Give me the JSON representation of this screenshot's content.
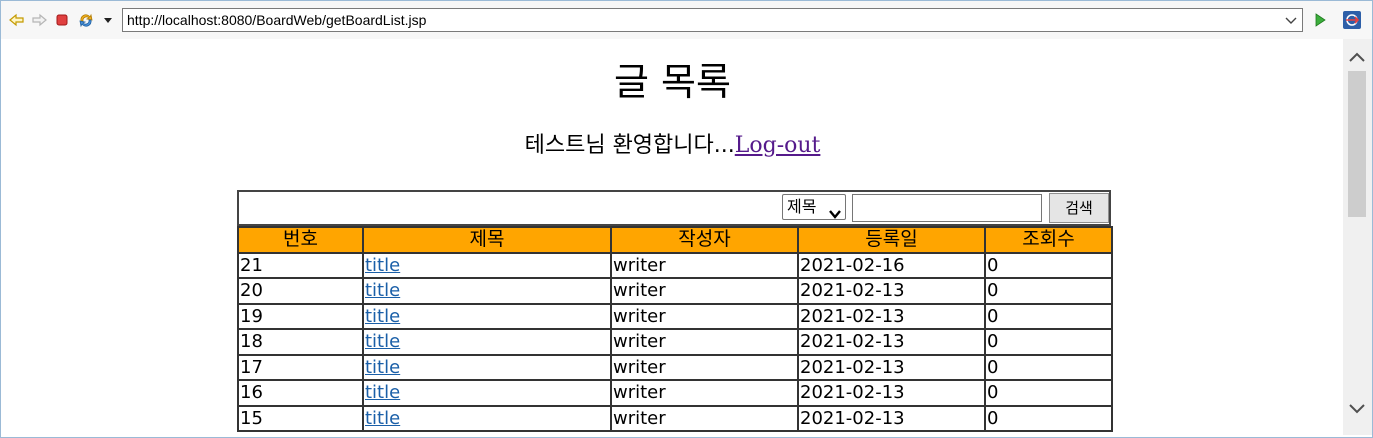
{
  "toolbar": {
    "url": "http://localhost:8080/BoardWeb/getBoardList.jsp",
    "icons": [
      "back-icon",
      "forward-icon",
      "stop-icon",
      "refresh-icon",
      "menu-dropdown-icon",
      "url-dropdown-icon",
      "go-icon",
      "external-browser-icon"
    ]
  },
  "page": {
    "title": "글 목록",
    "welcome_text": "테스트님 환영합니다...",
    "logout_label": "Log-out"
  },
  "search": {
    "select_value": "제목",
    "input_value": "",
    "button_label": "검색"
  },
  "table": {
    "headers": [
      "번호",
      "제목",
      "작성자",
      "등록일",
      "조회수"
    ],
    "rows": [
      {
        "seq": "21",
        "title": "title",
        "writer": "writer",
        "regdate": "2021-02-16",
        "cnt": "0"
      },
      {
        "seq": "20",
        "title": "title",
        "writer": "writer",
        "regdate": "2021-02-13",
        "cnt": "0"
      },
      {
        "seq": "19",
        "title": "title",
        "writer": "writer",
        "regdate": "2021-02-13",
        "cnt": "0"
      },
      {
        "seq": "18",
        "title": "title",
        "writer": "writer",
        "regdate": "2021-02-13",
        "cnt": "0"
      },
      {
        "seq": "17",
        "title": "title",
        "writer": "writer",
        "regdate": "2021-02-13",
        "cnt": "0"
      },
      {
        "seq": "16",
        "title": "title",
        "writer": "writer",
        "regdate": "2021-02-13",
        "cnt": "0"
      },
      {
        "seq": "15",
        "title": "title",
        "writer": "writer",
        "regdate": "2021-02-13",
        "cnt": "0"
      }
    ]
  },
  "colors": {
    "header_bg": "#ffa500",
    "link": "#1a5fa8",
    "visited_link": "#551a8b",
    "accent": "#0078d7"
  }
}
